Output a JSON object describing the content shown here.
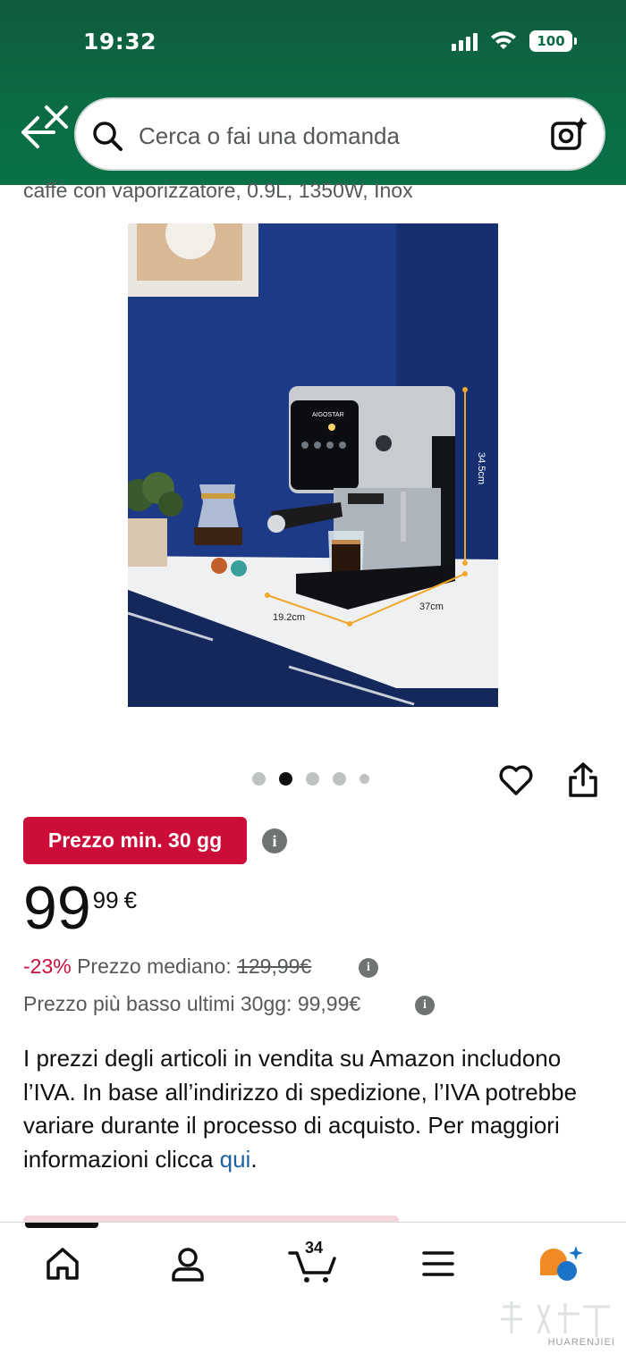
{
  "status_bar": {
    "time": "19:32",
    "battery": "100",
    "icons": [
      "signal-icon",
      "wifi-icon",
      "battery-icon"
    ]
  },
  "header": {
    "back_icon": "back-close-icon",
    "search": {
      "placeholder": "Cerca o fai una domanda",
      "search_icon": "search-icon",
      "camera_icon": "camera-lens-icon"
    }
  },
  "product": {
    "title_partial": "caffè con vaporizzatore, 0.9L, 1350W, Inox",
    "image": {
      "brand_on_machine": "AIGOSTAR",
      "dimension_height": "34.5cm",
      "dimension_width": "37cm",
      "dimension_depth": "19.2cm"
    },
    "carousel": {
      "count": 5,
      "active_index": 1
    },
    "actions": {
      "wishlist_icon": "heart-icon",
      "share_icon": "share-icon"
    },
    "deal_badge": "Prezzo min. 30 gg",
    "info_icon": "i",
    "price": {
      "whole": "99",
      "fraction": "99",
      "currency": "€"
    },
    "discount": "-23%",
    "median_label": "Prezzo mediano:",
    "median_price": "129,99€",
    "lowest_text": "Prezzo più basso ultimi 30gg: 99,99€",
    "vat_text": "I prezzi degli articoli in vendita su Amazon includono l’IVA. In base all’indirizzo di spedizione, l’IVA potrebbe variare durante il processo di acquisto. Per maggiori informazioni clicca ",
    "vat_link": "qui",
    "vat_end": "."
  },
  "bottom_nav": {
    "items": [
      "home-icon",
      "account-icon",
      "cart-icon",
      "menu-icon",
      "rufus-assistant-icon"
    ],
    "cart_count": "34",
    "active": "home"
  },
  "watermark": {
    "text": "HUARENJIEI"
  },
  "colors": {
    "header_green": "#0b6b43",
    "deal_red": "#cc0c39",
    "link_blue": "#2162a1",
    "text_dark": "#0f1111",
    "text_gray": "#565959"
  }
}
